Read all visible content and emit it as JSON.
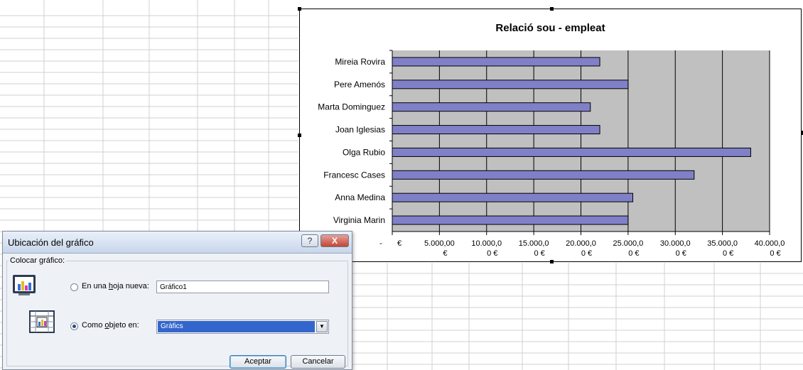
{
  "chart_data": {
    "type": "bar",
    "orientation": "horizontal",
    "title": "Relació sou - empleat",
    "categories": [
      "Mireia Rovira",
      "Pere Amenós",
      "Marta Dominguez",
      "Joan Iglesias",
      "Olga Rubio",
      "Francesc Cases",
      "Anna Medina",
      "Virginia Marin"
    ],
    "values": [
      22000,
      25000,
      21000,
      22000,
      38000,
      32000,
      25500,
      25000
    ],
    "x_tick_labels": [
      [
        "-",
        "€"
      ],
      [
        "5.000,00",
        "€"
      ],
      [
        "10.000,0",
        "0 €"
      ],
      [
        "15.000,0",
        "0 €"
      ],
      [
        "20.000,0",
        "0 €"
      ],
      [
        "25.000,0",
        "0 €"
      ],
      [
        "30.000,0",
        "0 €"
      ],
      [
        "35.000,0",
        "0 €"
      ],
      [
        "40.000,0",
        "0 €"
      ]
    ],
    "xlim": [
      0,
      40000
    ],
    "grid": true,
    "plot_background": "#c0c0c0",
    "bar_color": "#8080c8"
  },
  "dialog": {
    "title": "Ubicación del gráfico",
    "help_label": "?",
    "close_label": "X",
    "group_label": "Colocar gráfico:",
    "option_new_sheet": {
      "prefix": "En una ",
      "accel": "h",
      "suffix": "oja nueva:"
    },
    "new_sheet_value": "Gráfico1",
    "option_object": {
      "prefix": "Como ",
      "accel": "o",
      "suffix": "bjeto en:"
    },
    "object_value": "Gràfics",
    "ok_label": "Aceptar",
    "cancel_label": "Cancelar"
  }
}
